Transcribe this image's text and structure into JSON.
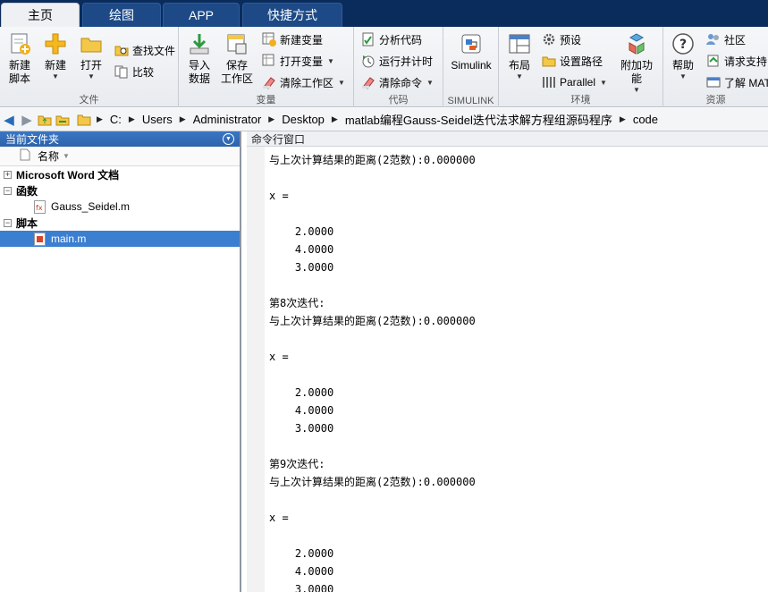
{
  "tabs": [
    {
      "label": "主页",
      "active": true
    },
    {
      "label": "绘图",
      "active": false
    },
    {
      "label": "APP",
      "active": false
    },
    {
      "label": "快捷方式",
      "active": false
    }
  ],
  "ribbon": {
    "file": {
      "label": "文件",
      "new_script": [
        "新建",
        "脚本"
      ],
      "new": "新建",
      "open": "打开",
      "find_files": "查找文件",
      "compare": "比较"
    },
    "variable": {
      "label": "变量",
      "import": [
        "导入",
        "数据"
      ],
      "save": [
        "保存",
        "工作区"
      ],
      "new_var": "新建变量",
      "open_var": "打开变量",
      "clear_ws": "清除工作区"
    },
    "code": {
      "label": "代码",
      "analyze": "分析代码",
      "run_time": "运行并计时",
      "clear_cmd": "清除命令"
    },
    "simulink": {
      "label": "SIMULINK",
      "btn": "Simulink"
    },
    "env": {
      "label": "环境",
      "layout": "布局",
      "prefs": "预设",
      "set_path": "设置路径",
      "parallel": "Parallel",
      "addons": "附加功能"
    },
    "resources": {
      "label": "资源",
      "help": "帮助",
      "community": "社区",
      "support": "请求支持",
      "learn": "了解 MAT"
    }
  },
  "address": {
    "crumbs": [
      "C:",
      "Users",
      "Administrator",
      "Desktop",
      "matlab编程Gauss-Seidel迭代法求解方程组源码程序",
      "code"
    ]
  },
  "left_panel": {
    "title": "当前文件夹",
    "col_name": "名称",
    "groups": [
      {
        "name": "Microsoft Word 文档",
        "expander": "+",
        "files": []
      },
      {
        "name": "函数",
        "expander": "−",
        "files": [
          "Gauss_Seidel.m"
        ]
      },
      {
        "name": "脚本",
        "expander": "−",
        "files": [
          "main.m"
        ]
      }
    ],
    "selected_file": "main.m"
  },
  "command_window": {
    "title": "命令行窗口",
    "lines": [
      "与上次计算结果的距离(2范数):0.000000",
      "",
      "x =",
      "",
      "    2.0000",
      "    4.0000",
      "    3.0000",
      "",
      "第8次迭代:",
      "与上次计算结果的距离(2范数):0.000000",
      "",
      "x =",
      "",
      "    2.0000",
      "    4.0000",
      "    3.0000",
      "",
      "第9次迭代:",
      "与上次计算结果的距离(2范数):0.000000",
      "",
      "x =",
      "",
      "    2.0000",
      "    4.0000",
      "    3.0000"
    ]
  }
}
